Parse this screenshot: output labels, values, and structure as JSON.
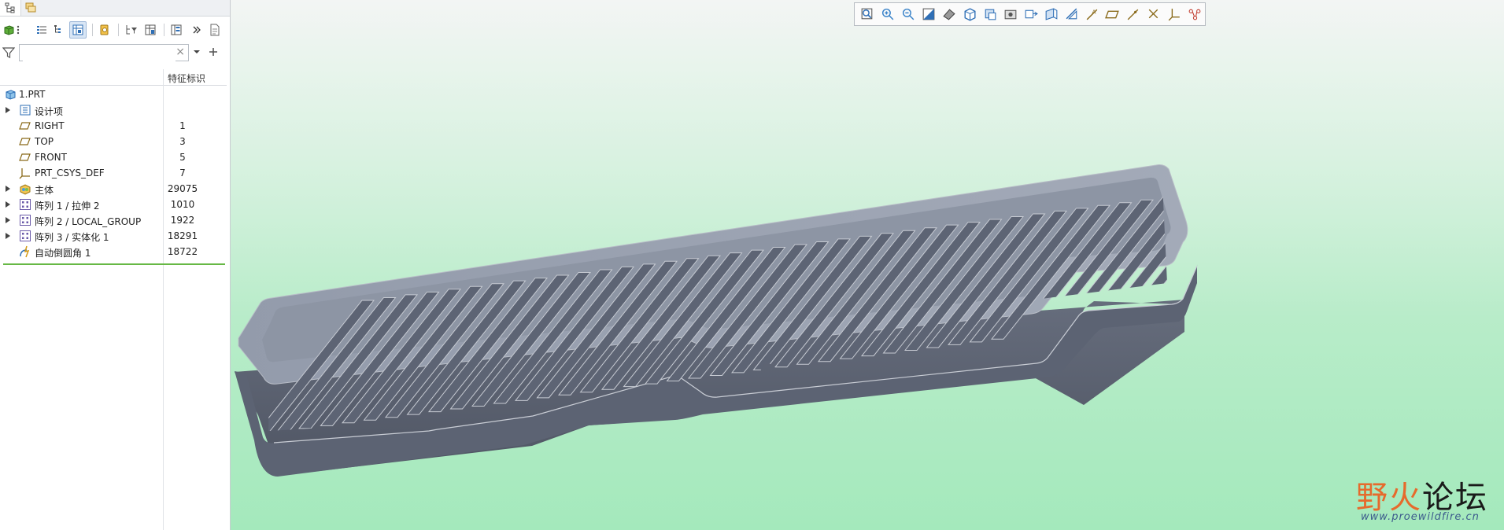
{
  "colors": {
    "accent": "#2f6fb6",
    "insert_line": "#67b845",
    "model_top": "#9aa2b0",
    "model_side": "#5a6070",
    "watermark_orange": "#e66a2c"
  },
  "panel_tabs": [
    {
      "name": "model-tree-tab",
      "icon": "tree-icon"
    },
    {
      "name": "layers-tab",
      "icon": "layers-icon"
    }
  ],
  "search": {
    "value": "",
    "placeholder": "",
    "clear": "×"
  },
  "tree": {
    "column_header": "特征标识",
    "items": [
      {
        "label": "1.PRT",
        "id": "",
        "icon": "part-icon",
        "expand": false
      },
      {
        "label": "设计项",
        "id": "",
        "icon": "design-items-icon",
        "expand": true
      },
      {
        "label": "RIGHT",
        "id": "1",
        "icon": "datum-plane-icon",
        "expand": false
      },
      {
        "label": "TOP",
        "id": "3",
        "icon": "datum-plane-icon",
        "expand": false
      },
      {
        "label": "FRONT",
        "id": "5",
        "icon": "datum-plane-icon",
        "expand": false
      },
      {
        "label": "PRT_CSYS_DEF",
        "id": "7",
        "icon": "csys-icon",
        "expand": false
      },
      {
        "label": "主体",
        "id": "29075",
        "icon": "body-icon",
        "expand": true
      },
      {
        "label": "阵列 1 / 拉伸 2",
        "id": "1010",
        "icon": "pattern-icon",
        "expand": true
      },
      {
        "label": "阵列 2 / LOCAL_GROUP",
        "id": "1922",
        "icon": "pattern-icon",
        "expand": true
      },
      {
        "label": "阵列 3 / 实体化 1",
        "id": "18291",
        "icon": "pattern-icon",
        "expand": true
      },
      {
        "label": "自动倒圆角 1",
        "id": "18722",
        "icon": "auto-round-icon",
        "expand": false
      }
    ]
  },
  "view_toolbar": [
    "refit-icon",
    "zoom-in-icon",
    "zoom-out-icon",
    "repaint-icon",
    "display-style-icon",
    "saved-orientations-icon",
    "view-manager-icon",
    "perspective-icon",
    "spin-center-icon",
    "annotation-display-icon",
    "plane-display-icon",
    "axis-display-icon",
    "point-display-icon",
    "csys-display-icon",
    "point-tag-icon",
    "csys-tag-icon",
    "spin-center-display-icon"
  ],
  "watermark": {
    "title_a": "野火",
    "title_b": "论坛",
    "url": "www.proewildfire.cn"
  }
}
